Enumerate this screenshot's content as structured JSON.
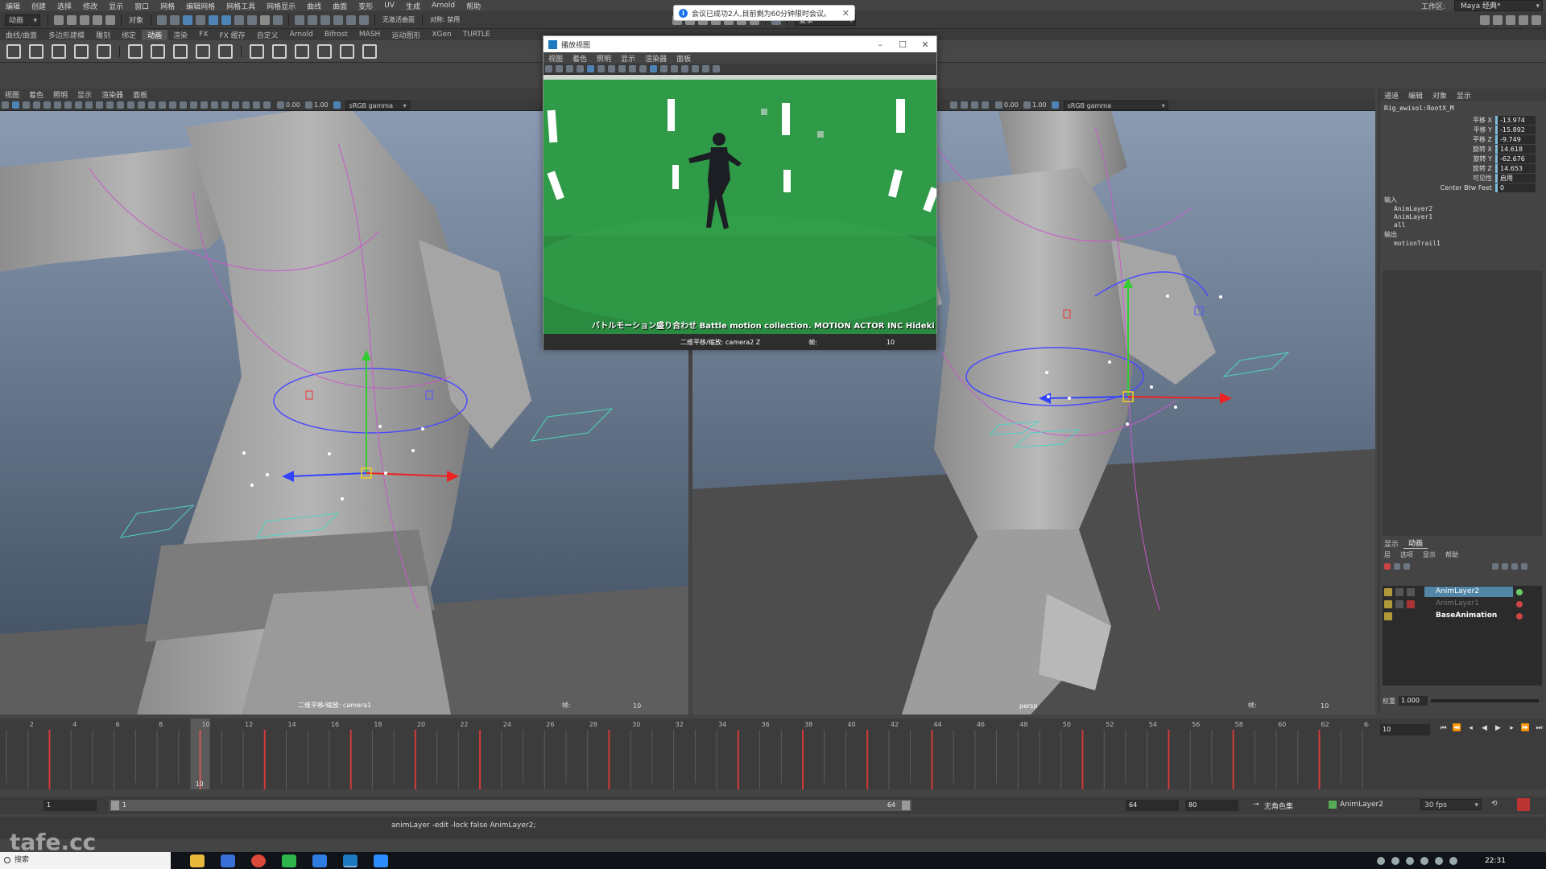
{
  "menubar": {
    "items": [
      "编辑",
      "创建",
      "选择",
      "修改",
      "显示",
      "窗口",
      "网格",
      "编辑网格",
      "网格工具",
      "网格显示",
      "曲线",
      "曲面",
      "变形",
      "UV",
      "生成",
      "Arnold",
      "帮助"
    ],
    "workspace_label": "工作区:",
    "workspace_value": "Maya 经典*"
  },
  "statusline": {
    "mode_dropdown": "动画",
    "object_label": "对象",
    "live_surface": "无激活曲面",
    "symmetry": "对称: 禁用",
    "login": "登录"
  },
  "toast": {
    "text": "会议已成功2人,目前剩为60分钟限时会议。"
  },
  "shelf": {
    "tabs": [
      "曲线/曲面",
      "多边形建模",
      "雕刻",
      "绑定",
      "动画",
      "渲染",
      "FX",
      "FX 缓存",
      "自定义",
      "Arnold",
      "Bifrost",
      "MASH",
      "运动图形",
      "XGen",
      "TURTLE"
    ],
    "active_tab": 4
  },
  "viewport_left": {
    "menu": [
      "视图",
      "着色",
      "照明",
      "显示",
      "渲染器",
      "面板"
    ],
    "exposure": "0.00",
    "gamma": "1.00",
    "color_space": "sRGB gamma",
    "camera_label": "二维平移/缩放: camera1",
    "fps_label": "帧:",
    "fps_value": "10"
  },
  "viewport_right": {
    "exposure": "0.00",
    "gamma": "1.00",
    "color_space": "sRGB gamma",
    "camera_label": "persp",
    "fps_label": "帧:",
    "fps_value": "10"
  },
  "video_window": {
    "title": "播放视图",
    "menu": [
      "视图",
      "着色",
      "照明",
      "显示",
      "渲染器",
      "面板"
    ],
    "subtitle": "バトルモーション盛り合わせ Battle motion collection. MOTION ACTOR INC Hideki Sug",
    "camera_label": "二维平移/缩放: camera2 Z",
    "fps_label": "帧:",
    "fps_value": "10"
  },
  "channel_box": {
    "tabs": [
      "通道",
      "编辑",
      "对象",
      "显示"
    ],
    "node": "Rig_ewisol:RootX_M",
    "attributes": [
      {
        "name": "平移 X",
        "value": "-13.974"
      },
      {
        "name": "平移 Y",
        "value": "-15.892"
      },
      {
        "name": "平移 Z",
        "value": "-9.749"
      },
      {
        "name": "旋转 X",
        "value": "14.618"
      },
      {
        "name": "旋转 Y",
        "value": "-62.676"
      },
      {
        "name": "旋转 Z",
        "value": "14.653"
      },
      {
        "name": "可见性",
        "value": "启用"
      },
      {
        "name": "Center Btw Feet",
        "value": "0"
      }
    ],
    "inputs_label": "输入",
    "inputs": [
      "AnimLayer2",
      "AnimLayer1",
      "all"
    ],
    "outputs_label": "输出",
    "outputs": [
      "motionTrail1"
    ]
  },
  "layer_editor": {
    "tabs": [
      "显示",
      "动画"
    ],
    "menu": [
      "层",
      "选项",
      "显示",
      "帮助"
    ],
    "layers": [
      {
        "name": "AnimLayer2",
        "selected": true
      },
      {
        "name": "AnimLayer1",
        "selected": false
      },
      {
        "name": "BaseAnimation",
        "selected": false
      }
    ],
    "weight_label": "权重",
    "weight_value": "1.000"
  },
  "timeline": {
    "start": 1,
    "end": 64,
    "current_frame": 10,
    "current_frame_field": "10",
    "keyframes": [
      3,
      10,
      13,
      17,
      20,
      23,
      29,
      35,
      38,
      41,
      44,
      51,
      55,
      58,
      62
    ]
  },
  "range": {
    "start_field": "1",
    "inner_start": "1",
    "inner_end": "64",
    "end_field": "64",
    "total_end": "80",
    "character_set": "无角色集",
    "anim_layer": "AnimLayer2",
    "fps": "30 fps"
  },
  "command_line": {
    "result": "animLayer -edit -lock false AnimLayer2;"
  },
  "watermark": "tafe.cc",
  "taskbar": {
    "search_placeholder": "搜索",
    "time": "22:31"
  },
  "colors": {
    "viewport_top": "#8a9bb2",
    "viewport_bottom": "#3c4a5c",
    "selected_layer": "#5285a6",
    "green_screen": "#2f9a47"
  }
}
